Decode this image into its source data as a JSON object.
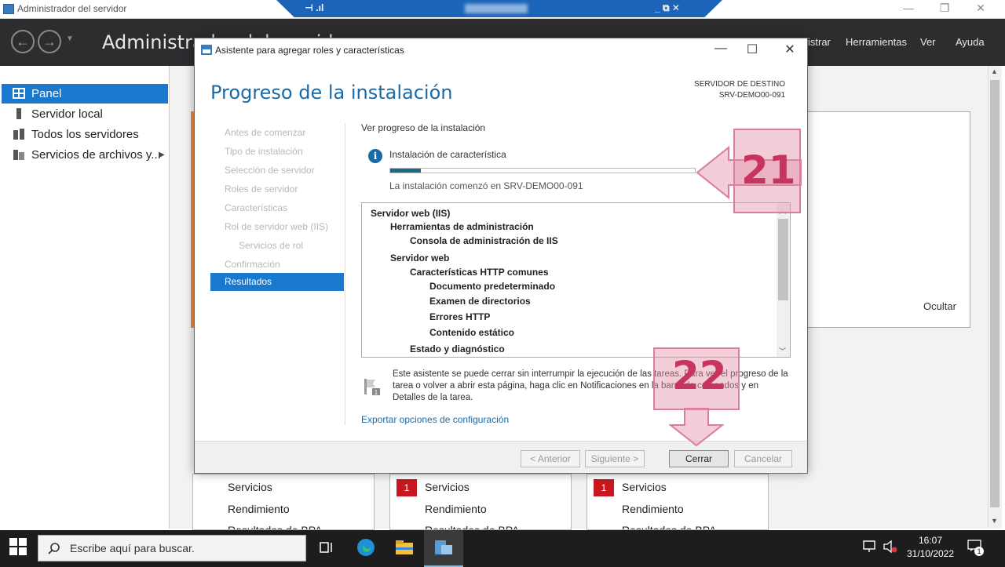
{
  "outer_window": {
    "title": "Administrador del servidor",
    "controls": {
      "minimize": "—",
      "maximize": "❐",
      "close": "✕"
    }
  },
  "rdp_bar": {
    "left_glyph": "⊣ .ıl",
    "controls": "_ ⧉ ✕"
  },
  "server_manager": {
    "title": "Administrador del servidor",
    "menu": [
      "istrar",
      "Herramientas",
      "Ver",
      "Ayuda"
    ],
    "sidebar": [
      {
        "label": "Panel",
        "active": true
      },
      {
        "label": "Servidor local",
        "active": false
      },
      {
        "label": "Todos los servidores",
        "active": false
      },
      {
        "label": "Servicios de archivos y...",
        "active": false
      }
    ],
    "hide_label": "Ocultar",
    "tiles": [
      {
        "badge": "",
        "rows": [
          "Servicios",
          "Rendimiento",
          "Resultados de BPA"
        ]
      },
      {
        "badge": "1",
        "rows": [
          "Servicios",
          "Rendimiento",
          "Resultados de BPA"
        ]
      },
      {
        "badge": "1",
        "rows": [
          "Servicios",
          "Rendimiento",
          "Resultados de BPA"
        ]
      }
    ]
  },
  "dialog": {
    "title": "Asistente para agregar roles y características",
    "heading": "Progreso de la instalación",
    "destination_label": "SERVIDOR DE DESTINO",
    "destination_name": "SRV-DEMO00-091",
    "steps": [
      {
        "label": "Antes de comenzar",
        "sub": false,
        "active": false
      },
      {
        "label": "Tipo de instalación",
        "sub": false,
        "active": false
      },
      {
        "label": "Selección de servidor",
        "sub": false,
        "active": false
      },
      {
        "label": "Roles de servidor",
        "sub": false,
        "active": false
      },
      {
        "label": "Características",
        "sub": false,
        "active": false
      },
      {
        "label": "Rol de servidor web (IIS)",
        "sub": false,
        "active": false
      },
      {
        "label": "Servicios de rol",
        "sub": true,
        "active": false
      },
      {
        "label": "Confirmación",
        "sub": false,
        "active": false
      },
      {
        "label": "Resultados",
        "sub": false,
        "active": true
      }
    ],
    "view_progress": "Ver progreso de la instalación",
    "install_type": "Instalación de característica",
    "progress_fraction": 0.1,
    "install_started": "La instalación comenzó en SRV-DEMO00-091",
    "tree": [
      {
        "label": "Servidor web (IIS)",
        "level": 0
      },
      {
        "label": "Herramientas de administración",
        "level": 1
      },
      {
        "label": "Consola de administración de IIS",
        "level": 2
      },
      {
        "label": "Servidor web",
        "level": 1
      },
      {
        "label": "Características HTTP comunes",
        "level": 2
      },
      {
        "label": "Documento predeterminado",
        "level": 3
      },
      {
        "label": "Examen de directorios",
        "level": 3
      },
      {
        "label": "Errores HTTP",
        "level": 3
      },
      {
        "label": "Contenido estático",
        "level": 3
      },
      {
        "label": "Estado y diagnóstico",
        "level": 2
      }
    ],
    "note": "Este asistente se puede cerrar sin interrumpir la ejecución de las tareas. Para ver el progreso de la tarea o volver a abrir esta página, haga clic en Notificaciones en la barra de comandos y en Detalles de la tarea.",
    "export_link": "Exportar opciones de configuración",
    "buttons": {
      "previous": "< Anterior",
      "next": "Siguiente >",
      "close": "Cerrar",
      "cancel": "Cancelar"
    }
  },
  "callouts": [
    {
      "number": "21"
    },
    {
      "number": "22"
    }
  ],
  "taskbar": {
    "search_placeholder": "Escribe aquí para buscar.",
    "time": "16:07",
    "date": "31/10/2022",
    "notification_count": "1"
  },
  "colors": {
    "accent": "#1a79cc",
    "heading": "#1a6aa8",
    "progress": "#1b6a84",
    "header_dark": "#2d2d30",
    "callout": "#c7345e",
    "badge": "#c8171e"
  }
}
